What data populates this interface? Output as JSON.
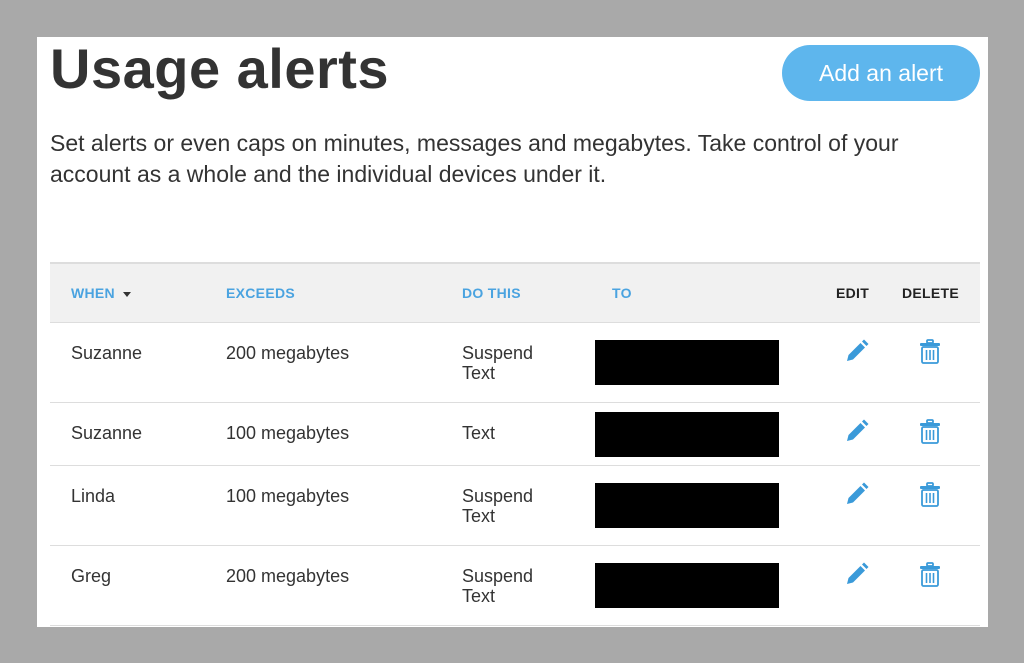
{
  "header": {
    "title": "Usage alerts",
    "add_button_label": "Add an alert",
    "description": "Set alerts or even caps on minutes, messages and megabytes. Take control of your account as a whole and the individual devices under it."
  },
  "table": {
    "columns": {
      "when": "WHEN",
      "exceeds": "EXCEEDS",
      "do_this": "DO THIS",
      "to": "TO",
      "edit": "EDIT",
      "delete": "DELETE"
    },
    "rows": [
      {
        "when": "Suzanne",
        "exceeds": "200 megabytes",
        "do_this_1": "Suspend",
        "do_this_2": "Text"
      },
      {
        "when": "Suzanne",
        "exceeds": "100 megabytes",
        "do_this_1": "Text",
        "do_this_2": ""
      },
      {
        "when": "Linda",
        "exceeds": "100 megabytes",
        "do_this_1": "Suspend",
        "do_this_2": "Text"
      },
      {
        "when": "Greg",
        "exceeds": "200 megabytes",
        "do_this_1": "Suspend",
        "do_this_2": "Text"
      }
    ]
  },
  "colors": {
    "accent": "#5eb6ed",
    "header_link": "#4aa3e0",
    "icon": "#3a9ad9",
    "background": "#a9a9a9"
  },
  "icons": {
    "edit": "pencil-icon",
    "delete": "trash-icon",
    "sort": "caret-down-icon"
  }
}
